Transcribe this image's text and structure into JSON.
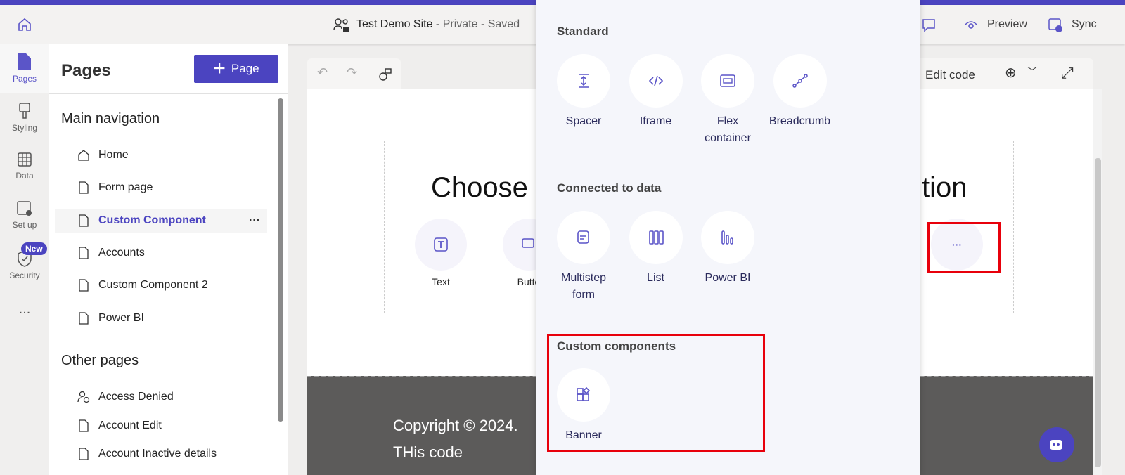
{
  "header": {
    "site_name": "Test Demo Site",
    "site_status": " - Private - Saved",
    "preview_label": "Preview",
    "sync_label": "Sync"
  },
  "rail": [
    {
      "label": "Pages",
      "icon": "page-icon"
    },
    {
      "label": "Styling",
      "icon": "brush-icon"
    },
    {
      "label": "Data",
      "icon": "table-icon"
    },
    {
      "label": "Set up",
      "icon": "setup-icon"
    },
    {
      "label": "Security",
      "icon": "shield-icon",
      "badge": "New"
    },
    {
      "label": "...",
      "icon": "more-icon"
    }
  ],
  "pages": {
    "title": "Pages",
    "add_button": "Page",
    "main_nav_title": "Main navigation",
    "main_nav": [
      {
        "label": "Home",
        "icon": "home-icon"
      },
      {
        "label": "Form page",
        "icon": "page-icon"
      },
      {
        "label": "Custom Component",
        "icon": "page-icon",
        "selected": true
      },
      {
        "label": "Accounts",
        "icon": "page-icon"
      },
      {
        "label": "Custom Component 2",
        "icon": "page-icon"
      },
      {
        "label": "Power BI",
        "icon": "page-icon"
      }
    ],
    "other_title": "Other pages",
    "other": [
      {
        "label": "Access Denied",
        "icon": "user-blocked-icon"
      },
      {
        "label": "Account Edit",
        "icon": "page-icon"
      },
      {
        "label": "Account Inactive details",
        "icon": "page-icon"
      }
    ],
    "more": "···"
  },
  "toolbar": {
    "edit_code": "Edit code"
  },
  "canvas": {
    "heading_left": "Choose a",
    "heading_right": "tion",
    "components": [
      {
        "label": "Text"
      },
      {
        "label": "Butto"
      }
    ],
    "more": "···",
    "footer_line1": "Copyright © 2024.",
    "footer_line2": "THis code"
  },
  "panel": {
    "standard_title": "Standard",
    "standard": [
      {
        "label": "Spacer",
        "icon": "spacer-icon"
      },
      {
        "label": "Iframe",
        "icon": "code-icon"
      },
      {
        "label": "Flex container",
        "icon": "flex-container-icon"
      },
      {
        "label": "Breadcrumb",
        "icon": "breadcrumb-icon"
      }
    ],
    "data_title": "Connected to data",
    "data": [
      {
        "label": "Multistep form",
        "icon": "form-icon"
      },
      {
        "label": "List",
        "icon": "list-icon"
      },
      {
        "label": "Power BI",
        "icon": "powerbi-icon"
      }
    ],
    "custom_title": "Custom components",
    "custom": [
      {
        "label": "Banner",
        "icon": "component-icon"
      }
    ]
  },
  "colors": {
    "accent": "#4b44c0",
    "highlight": "#e8000b",
    "footer": "#5c5b5a"
  }
}
